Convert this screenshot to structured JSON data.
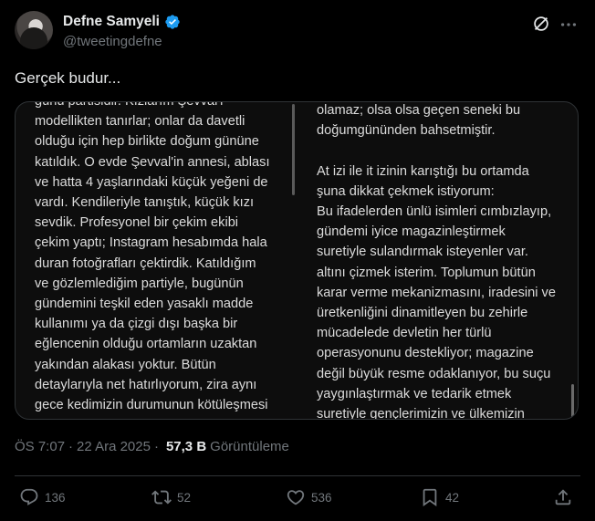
{
  "author": {
    "display_name": "Defne Samyeli",
    "handle": "@tweetingdefne",
    "verified": true
  },
  "tweet": {
    "text": "Gerçek budur...",
    "time": "ÖS 7:07",
    "separator": "·",
    "date": "22 Ara 2025",
    "views_count": "57,3 B",
    "views_label": "Görüntüleme"
  },
  "media": {
    "left_column": [
      "günü partisidir. Kızlarım Şevval'i",
      "modellikten tanırlar; onlar da davetli",
      "olduğu için hep birlikte doğum gününe",
      "katıldık. O evde Şevval'in annesi, ablası",
      "ve hatta 4 yaşlarındaki küçük yeğeni de",
      "vardı. Kendileriyle tanıştık, küçük kızı",
      "sevdik. Profesyonel bir çekim ekibi",
      "çekim yaptı; Instagram hesabımda hala",
      "duran fotoğrafları çektirdik. Katıldığım",
      "ve gözlemlediğim partiyle, bugünün",
      "gündemini teşkil eden yasaklı madde",
      "kullanımı ya da çizgi dışı başka bir",
      "eğlencenin olduğu ortamların uzaktan",
      "yakından alakası yoktur. Bütün",
      "detaylarıyla net hatırlıyorum, zira aynı",
      "gece kedimizin durumunun kötüleşmesi"
    ],
    "right_column": [
      "olamaz; olsa olsa geçen seneki bu",
      "doğumgününden bahsetmiştir.",
      "",
      "At izi ile it izinin karıştığı bu ortamda",
      "şuna dikkat çekmek istiyorum:",
      "Bu ifadelerden ünlü isimleri cımbızlayıp,",
      "gündemi iyice magazinleştirmek",
      "suretiyle sulandırmak isteyenler var.",
      "altını çizmek isterim. Toplumun bütün",
      "karar verme mekanizmasını, iradesini ve",
      "üretkenliğini dinamitleyen bu zehirle",
      "mücadelede devletin her türlü",
      "operasyonunu destekliyor; magazine",
      "değil büyük resme odaklanıyor, bu suçu",
      "yaygınlaştırmak ve tedarik etmek",
      "suretiyle gençlerimizin ve ülkemizin"
    ]
  },
  "actions": {
    "replies": "136",
    "reposts": "52",
    "likes": "536",
    "bookmarks": "42"
  },
  "icons": {
    "verified": "verified-badge-icon",
    "grok": "grok-icon",
    "more": "more-icon",
    "reply": "reply-icon",
    "repost": "repost-icon",
    "like": "like-icon",
    "bookmark": "bookmark-icon",
    "share": "share-icon"
  },
  "colors": {
    "background": "#000000",
    "text": "#e7e9ea",
    "secondary": "#71767b",
    "verified": "#1d9bf0",
    "border": "#2f3336"
  }
}
